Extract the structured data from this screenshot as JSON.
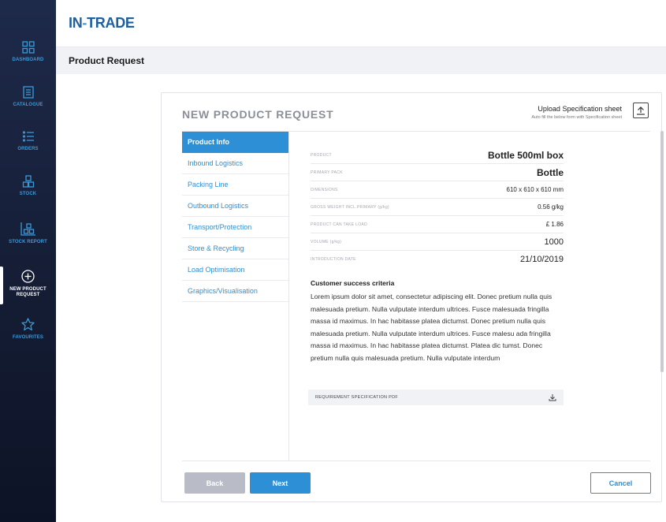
{
  "app": {
    "logo_prefix": "IN",
    "logo_dash": "-",
    "logo_suffix": "TRADE"
  },
  "sidebar": {
    "items": [
      {
        "label": "DASHBOARD",
        "icon": "dashboard-icon"
      },
      {
        "label": "CATALOGUE",
        "icon": "catalogue-icon"
      },
      {
        "label": "ORDERS",
        "icon": "orders-icon"
      },
      {
        "label": "STOCK",
        "icon": "stock-icon"
      },
      {
        "label": "STOCK REPORT",
        "icon": "stock-report-icon"
      },
      {
        "label": "NEW PRODUCT REQUEST",
        "icon": "plus-circle-icon",
        "active": true
      },
      {
        "label": "FAVOURITES",
        "icon": "star-icon"
      }
    ]
  },
  "header": {
    "page_title": "Product Request"
  },
  "card": {
    "title": "NEW PRODUCT REQUEST",
    "upload_title": "Upload Specification sheet",
    "upload_sub": "Auto fill the below form with Specification sheet"
  },
  "menu": {
    "items": [
      "Product Info",
      "Inbound Logistics",
      "Packing Line",
      "Outbound Logistics",
      "Transport/Protection",
      "Store & Recycling",
      "Load Optimisation",
      "Graphics/Visualisation"
    ],
    "active_index": 0
  },
  "details": {
    "rows": [
      {
        "label": "PRODUCT",
        "value": "Bottle 500ml box"
      },
      {
        "label": "PRIMARY PACK",
        "value": "Bottle"
      },
      {
        "label": "DIMENSIONS",
        "value": "610 x 610 x 610 mm"
      },
      {
        "label": "GROSS WEIGHT INCL.PRIMARY (g/kg)",
        "value": "0.56 g/kg"
      },
      {
        "label": "PRODUCT CAN TAKE LOAD",
        "value": "£ 1.86"
      },
      {
        "label": "VOLUME (g/kg)",
        "value": "1000"
      },
      {
        "label": "INTRODUCTION DATE",
        "value": "21/10/2019"
      }
    ]
  },
  "criteria": {
    "title": "Customer success criteria",
    "text": "Lorem ipsum dolor sit amet, consectetur adipiscing elit. Donec pretium nulla quis malesuada pretium. Nulla vulputate interdum ultrices. Fusce malesuada fringilla massa id maximus. In hac habitasse platea dictumst. Donec pretium nulla quis malesuada pretium. Nulla vulputate interdum ultrices. Fusce malesu ada fringilla massa id maximus. In hac habitasse platea dictumst. Platea dic tumst. Donec pretium nulla quis malesuada pretium. Nulla vulputate interdum"
  },
  "pdf": {
    "label": "REQUIREMENT SPECIFICATION PDF"
  },
  "footer": {
    "back_label": "Back",
    "next_label": "Next",
    "cancel_label": "Cancel"
  },
  "colors": {
    "accent": "#2d8fd6",
    "sidebar": "#141c33",
    "logo": "#1f5f9e"
  }
}
